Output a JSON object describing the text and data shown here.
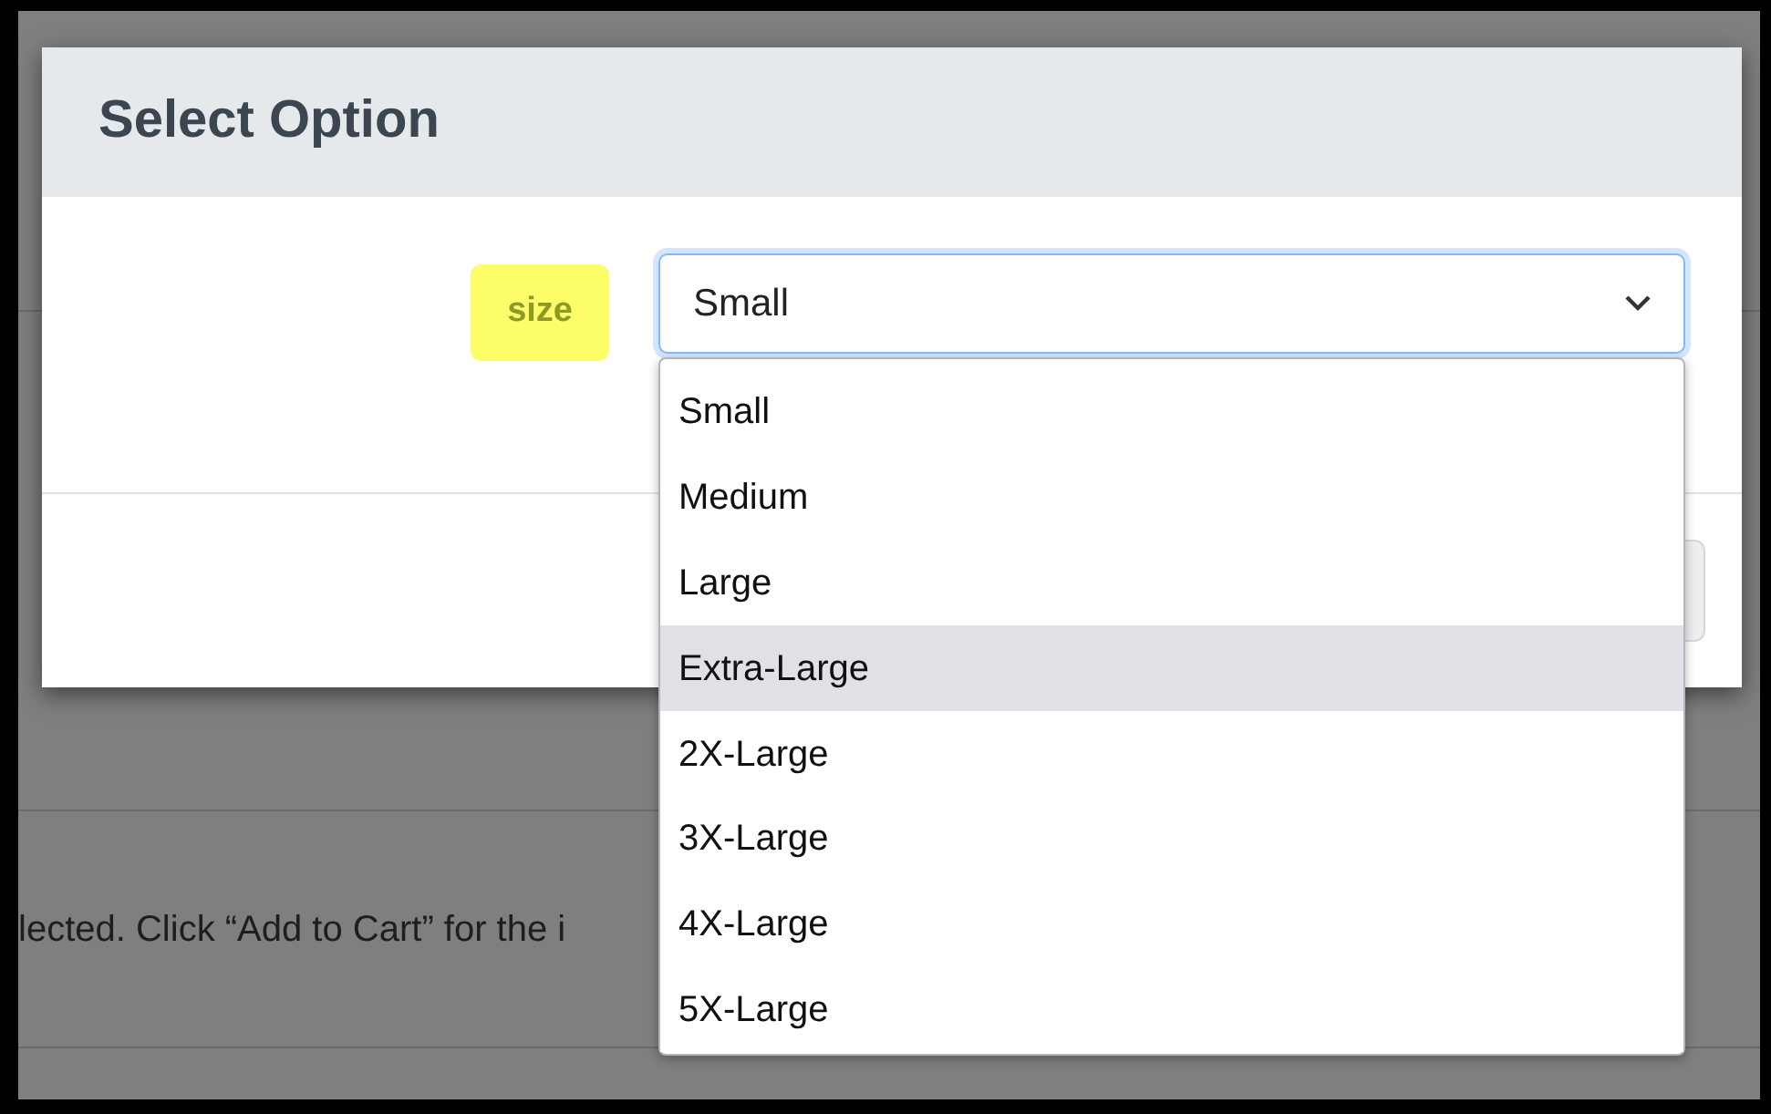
{
  "background_page": {
    "text": "lected. Click “Add to Cart” for the i"
  },
  "dialog": {
    "title": "Select Option",
    "field": {
      "label": "size",
      "value": "Small",
      "expanded": true
    },
    "options": [
      {
        "label": "Small",
        "highlighted": false
      },
      {
        "label": "Medium",
        "highlighted": false
      },
      {
        "label": "Large",
        "highlighted": false
      },
      {
        "label": "Extra-Large",
        "highlighted": true
      },
      {
        "label": "2X-Large",
        "highlighted": false
      },
      {
        "label": "3X-Large",
        "highlighted": false
      },
      {
        "label": "4X-Large",
        "highlighted": false
      },
      {
        "label": "5X-Large",
        "highlighted": false
      }
    ]
  }
}
